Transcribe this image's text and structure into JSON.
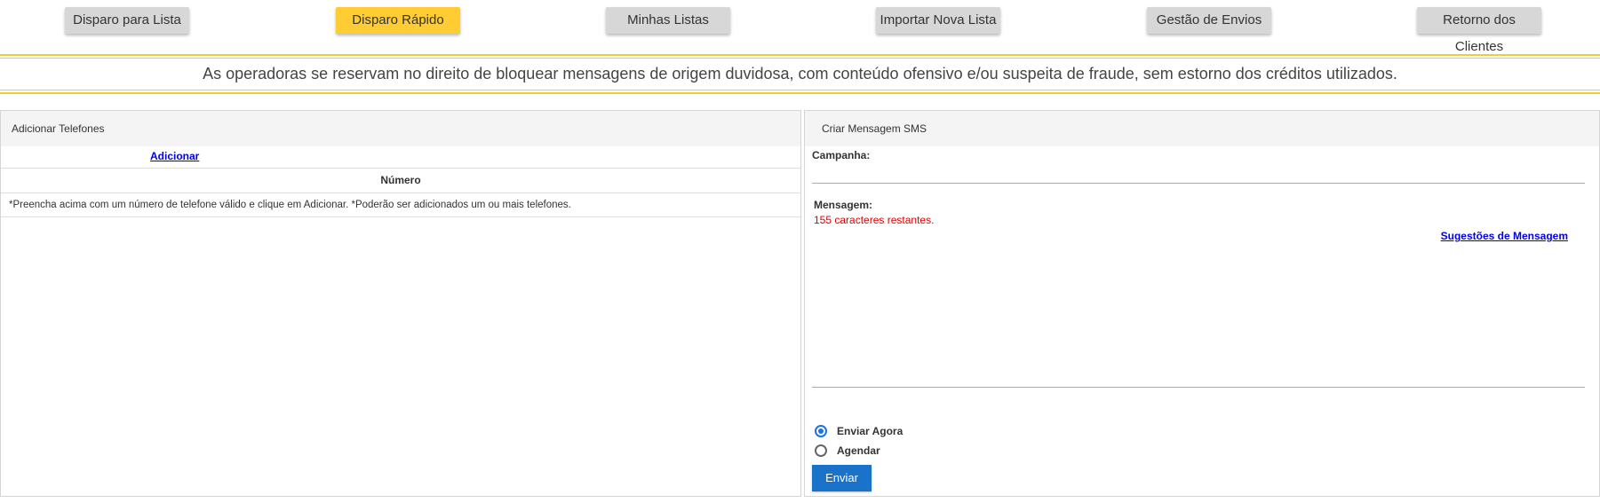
{
  "nav": {
    "items": [
      {
        "label": "Disparo para Lista",
        "active": false
      },
      {
        "label": "Disparo Rápido",
        "active": true
      },
      {
        "label": "Minhas Listas",
        "active": false
      },
      {
        "label": "Importar Nova Lista",
        "active": false
      },
      {
        "label": "Gestão de Envios",
        "active": false
      },
      {
        "label": "Retorno dos Clientes",
        "active": false
      }
    ]
  },
  "warning": "As operadoras se reservam no direito de bloquear mensagens de origem duvidosa, com conteúdo ofensivo e/ou suspeita de fraude, sem estorno dos créditos utilizados.",
  "phones_panel": {
    "title": "Adicionar Telefones",
    "add_link": "Adicionar",
    "column_header": "Número",
    "hint": "*Preencha acima com um número de telefone válido e clique em Adicionar. *Poderão ser adicionados um ou mais telefones."
  },
  "sms_panel": {
    "title": "Criar Mensagem SMS",
    "campaign_label": "Campanha:",
    "campaign_value": "",
    "message_label": "Mensagem:",
    "message_value": "",
    "counter": "155 caracteres restantes.",
    "suggestions_link": "Sugestões de Mensagem",
    "schedule_options": [
      {
        "label": "Enviar Agora",
        "selected": true
      },
      {
        "label": "Agendar",
        "selected": false
      }
    ],
    "send_label": "Enviar"
  },
  "colors": {
    "active_tab": "#ffcc33",
    "tab": "#d7d7d7",
    "warning_border": "#f3cd2e",
    "primary": "#1a73c8",
    "counter": "#e00000"
  }
}
